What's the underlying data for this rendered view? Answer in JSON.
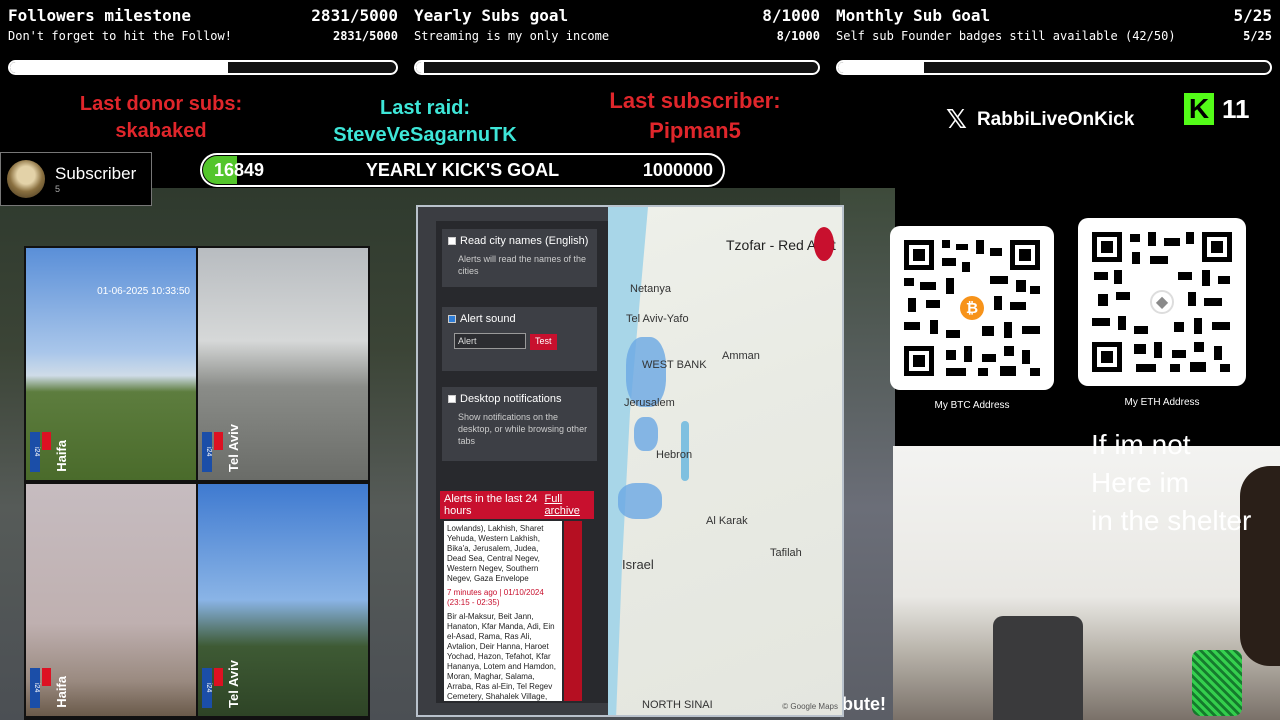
{
  "goals": [
    {
      "title": "Followers milestone",
      "count_top": "2831/5000",
      "subtitle": "Don't forget to hit the Follow!",
      "count_bottom": "2831/5000",
      "progress": 0.566
    },
    {
      "title": "Yearly Subs goal",
      "count_top": "8/1000",
      "subtitle": "Streaming is my only income",
      "count_bottom": "8/1000",
      "progress": 0.008
    },
    {
      "title": "Monthly Sub Goal",
      "count_top": "5/25",
      "subtitle": "Self sub Founder badges still available (42/50)",
      "count_bottom": "5/25",
      "progress": 0.2
    }
  ],
  "info": {
    "last_donor_label": "Last donor subs:",
    "last_donor_name": "skabaked",
    "last_raid_label": "Last raid:",
    "last_raid_name": "SteveVeSagarnuTK",
    "last_sub_label": "Last subscriber:",
    "last_sub_name": "Pipman5"
  },
  "subscriber_box": {
    "label": "Subscriber",
    "count": "5"
  },
  "kick_goal": {
    "current": "16849",
    "label": "YEARLY KICK'S GOAL",
    "target": "1000000",
    "progress": 0.0168
  },
  "social": {
    "x_handle": "RabbiLiveOnKick",
    "kick_logo": "K",
    "kick_count": "11"
  },
  "cameras": [
    {
      "city": "Haifa",
      "logo": "i24",
      "timestamp": "01-06-2025 10:33:50"
    },
    {
      "city": "Tel Aviv",
      "logo": "i24",
      "timestamp": ""
    },
    {
      "city": "Haifa",
      "logo": "i24",
      "timestamp": ""
    },
    {
      "city": "Tel Aviv",
      "logo": "i24",
      "timestamp": ""
    }
  ],
  "alert_app": {
    "title": "Tzofar - Red Alert",
    "opt_city_names": "Read city names (English)",
    "opt_city_names_desc": "Alerts will read the names of the cities",
    "opt_alert_sound": "Alert sound",
    "sound_select": "Alert",
    "test_button": "Test",
    "opt_desktop": "Desktop notifications",
    "opt_desktop_desc": "Show notifications on the desktop, or while browsing other tabs",
    "alerts_header": "Alerts in the last 24 hours",
    "full_archive": "Full archive",
    "alert_text_1": "Lowlands), Lakhish, Sharet Yehuda, Western Lakhish, Bika'a, Jerusalem, Judea, Dead Sea, Central Negev, Western Negev, Southern Negev, Gaza Envelope",
    "alert_time": "7 minutes ago | 01/10/2024 (23:15 - 02:35)",
    "alert_text_2": "Bir al-Maksur, Beit Jann, Hanaton, Kfar Manda, Adi, Ein el-Asad, Rama, Ras Ali, Avtalion, Deir Hanna, Haroet Yochad, Hazon, Tefahot, Kfar Hananya, Lotem and Hamdon, Moran, Maghar, Salama, Arraba, Ras al-Ein, Tel Regev Cemetery, Shahalek Village, Sawaid Humeira, Salled - 'Akbara, Hila, Kfar Nehar HaYarden, Maona, Mi'ilya, Ma'alot Tarshicha, Mitzpeh Aviim, Kidmat",
    "map_labels": [
      "Netanya",
      "Tel Aviv-Yafo",
      "WEST BANK",
      "Amman",
      "Jerusalem",
      "Hebron",
      "Israel",
      "Al Karak",
      "Tafilah",
      "NORTH SINAI"
    ],
    "map_attribution": "© Google Maps"
  },
  "wallets": [
    {
      "caption": "My BTC Address",
      "coin": "₿"
    },
    {
      "caption": "My ETH Address",
      "coin": "◆"
    }
  ],
  "shelter_note": [
    "If im not",
    "Here im",
    "in the shelter"
  ],
  "deco_text": "bute!",
  "colors": {
    "red": "#e0262b",
    "cyan": "#3ee6d8",
    "kick_green": "#53fc18",
    "alert_red": "#c8102e"
  }
}
